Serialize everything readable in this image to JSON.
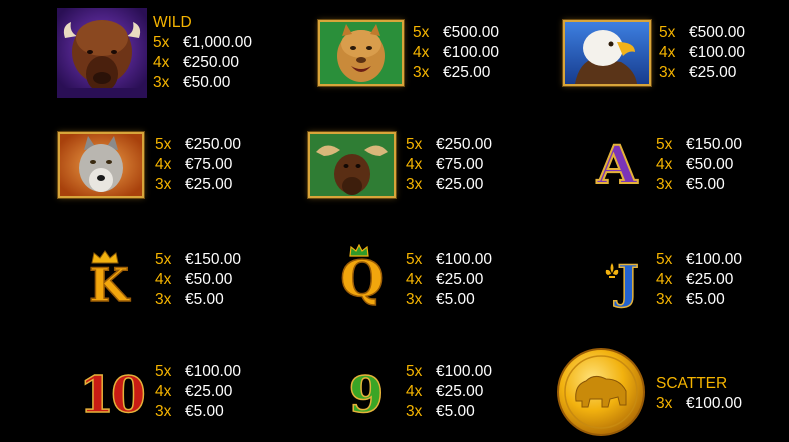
{
  "symbols": [
    {
      "id": "bison",
      "label": "WILD",
      "icon": "bison-icon",
      "pays": [
        {
          "m": "5x",
          "v": "€1,000.00"
        },
        {
          "m": "4x",
          "v": "€250.00"
        },
        {
          "m": "3x",
          "v": "€50.00"
        }
      ]
    },
    {
      "id": "cougar",
      "icon": "cougar-icon",
      "pays": [
        {
          "m": "5x",
          "v": "€500.00"
        },
        {
          "m": "4x",
          "v": "€100.00"
        },
        {
          "m": "3x",
          "v": "€25.00"
        }
      ]
    },
    {
      "id": "eagle",
      "icon": "eagle-icon",
      "pays": [
        {
          "m": "5x",
          "v": "€500.00"
        },
        {
          "m": "4x",
          "v": "€100.00"
        },
        {
          "m": "3x",
          "v": "€25.00"
        }
      ]
    },
    {
      "id": "wolf",
      "icon": "wolf-icon",
      "pays": [
        {
          "m": "5x",
          "v": "€250.00"
        },
        {
          "m": "4x",
          "v": "€75.00"
        },
        {
          "m": "3x",
          "v": "€25.00"
        }
      ]
    },
    {
      "id": "moose",
      "icon": "moose-icon",
      "pays": [
        {
          "m": "5x",
          "v": "€250.00"
        },
        {
          "m": "4x",
          "v": "€75.00"
        },
        {
          "m": "3x",
          "v": "€25.00"
        }
      ]
    },
    {
      "id": "ace",
      "glyph": "A",
      "icon": "letter-a-icon",
      "pays": [
        {
          "m": "5x",
          "v": "€150.00"
        },
        {
          "m": "4x",
          "v": "€50.00"
        },
        {
          "m": "3x",
          "v": "€5.00"
        }
      ]
    },
    {
      "id": "king",
      "glyph": "K",
      "icon": "letter-k-icon",
      "pays": [
        {
          "m": "5x",
          "v": "€150.00"
        },
        {
          "m": "4x",
          "v": "€50.00"
        },
        {
          "m": "3x",
          "v": "€5.00"
        }
      ]
    },
    {
      "id": "queen",
      "glyph": "Q",
      "icon": "letter-q-icon",
      "pays": [
        {
          "m": "5x",
          "v": "€100.00"
        },
        {
          "m": "4x",
          "v": "€25.00"
        },
        {
          "m": "3x",
          "v": "€5.00"
        }
      ]
    },
    {
      "id": "jack",
      "glyph": "J",
      "icon": "letter-j-icon",
      "pays": [
        {
          "m": "5x",
          "v": "€100.00"
        },
        {
          "m": "4x",
          "v": "€25.00"
        },
        {
          "m": "3x",
          "v": "€5.00"
        }
      ]
    },
    {
      "id": "ten",
      "glyph": "10",
      "icon": "number-10-icon",
      "pays": [
        {
          "m": "5x",
          "v": "€100.00"
        },
        {
          "m": "4x",
          "v": "€25.00"
        },
        {
          "m": "3x",
          "v": "€5.00"
        }
      ]
    },
    {
      "id": "nine",
      "glyph": "9",
      "icon": "number-9-icon",
      "pays": [
        {
          "m": "5x",
          "v": "€100.00"
        },
        {
          "m": "4x",
          "v": "€25.00"
        },
        {
          "m": "3x",
          "v": "€5.00"
        }
      ]
    },
    {
      "id": "coin",
      "label": "SCATTER",
      "icon": "bison-coin-icon",
      "pays": [
        {
          "m": "3x",
          "v": "€100.00"
        }
      ]
    }
  ],
  "colors": {
    "background": "#000000",
    "multiplier": "#f5b400",
    "amount": "#ffffff",
    "frame": "#d8a53a",
    "purple": "#6a2fa8",
    "gold": "#f2b20f",
    "blue": "#1d58c9",
    "red": "#c31b14",
    "green": "#3ca424"
  }
}
